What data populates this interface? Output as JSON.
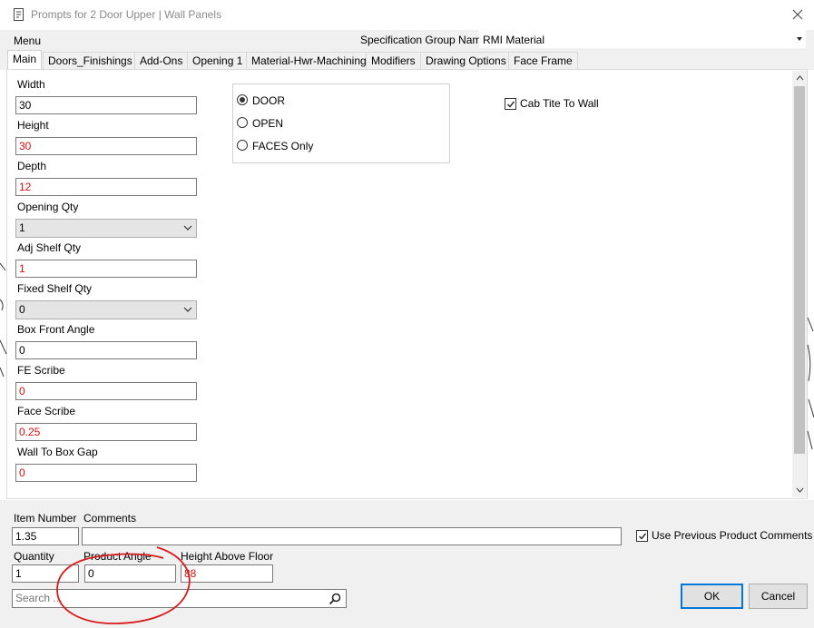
{
  "window": {
    "title": "Prompts for 2 Door Upper | Wall Panels"
  },
  "menu": {
    "label": "Menu"
  },
  "spec_group": {
    "label": "Specification Group Name",
    "value": "RMI Material"
  },
  "tabs": [
    {
      "label": "Main",
      "active": true
    },
    {
      "label": "Doors_Finishings"
    },
    {
      "label": "Add-Ons"
    },
    {
      "label": "Opening 1"
    },
    {
      "label": "Material-Hwr-Machining"
    },
    {
      "label": "Modifiers"
    },
    {
      "label": "Drawing Options"
    },
    {
      "label": "Face Frame"
    }
  ],
  "fields": {
    "width": {
      "label": "Width",
      "value": "30"
    },
    "height": {
      "label": "Height",
      "value": "30"
    },
    "depth": {
      "label": "Depth",
      "value": "12"
    },
    "opening_qty": {
      "label": "Opening Qty",
      "value": "1"
    },
    "adj_shelf_qty": {
      "label": "Adj Shelf Qty",
      "value": "1"
    },
    "fixed_shelf_qty": {
      "label": "Fixed Shelf Qty",
      "value": "0"
    },
    "box_front_angle": {
      "label": "Box Front Angle",
      "value": "0"
    },
    "fe_scribe": {
      "label": "FE Scribe",
      "value": "0"
    },
    "face_scribe": {
      "label": "Face Scribe",
      "value": "0.25"
    },
    "wall_to_box_gap": {
      "label": "Wall To Box Gap",
      "value": "0"
    }
  },
  "door_type": {
    "options": [
      "DOOR",
      "OPEN",
      "FACES Only"
    ],
    "selected": "DOOR"
  },
  "cab_tite_to_wall": {
    "label": "Cab Tite To Wall",
    "checked": true
  },
  "bottom": {
    "item_number": {
      "label": "Item Number",
      "value": "1.35"
    },
    "comments": {
      "label": "Comments",
      "value": ""
    },
    "use_previous_comments": {
      "label": "Use Previous Product Comments",
      "checked": true
    },
    "quantity": {
      "label": "Quantity",
      "value": "1"
    },
    "product_angle": {
      "label": "Product Angle",
      "value": "0"
    },
    "height_above_floor": {
      "label": "Height Above Floor",
      "value": "88"
    },
    "search": {
      "placeholder": "Search ..."
    },
    "ok_label": "OK",
    "cancel_label": "Cancel"
  },
  "colors": {
    "modified_value": "#e01010",
    "annotation": "#d71a1a",
    "ok_border": "#0078d7"
  },
  "icons": [
    "document-icon",
    "close-icon",
    "dropdown-arrow-icon",
    "chevron-down-icon",
    "scroll-up-icon",
    "scroll-down-icon",
    "search-icon",
    "checkmark-icon",
    "radio-dot-icon"
  ]
}
